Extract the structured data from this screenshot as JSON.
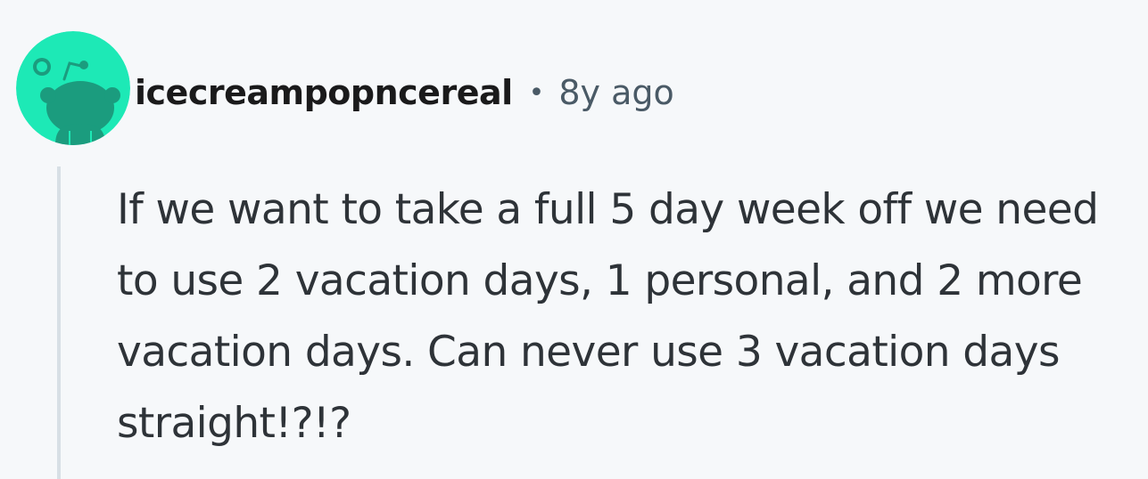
{
  "comment": {
    "author": "icecreampopncereal",
    "separator": "•",
    "timestamp": "8y ago",
    "body": "If we want to take a full 5 day week off we need to use 2 vacation days, 1 personal, and 2 more vacation days. Can never use 3 vacation days straight!?!?"
  },
  "avatar": {
    "icon": "reddit-snoo-icon",
    "background_color": "#1de9b6",
    "figure_color": "#1b9c7e"
  }
}
